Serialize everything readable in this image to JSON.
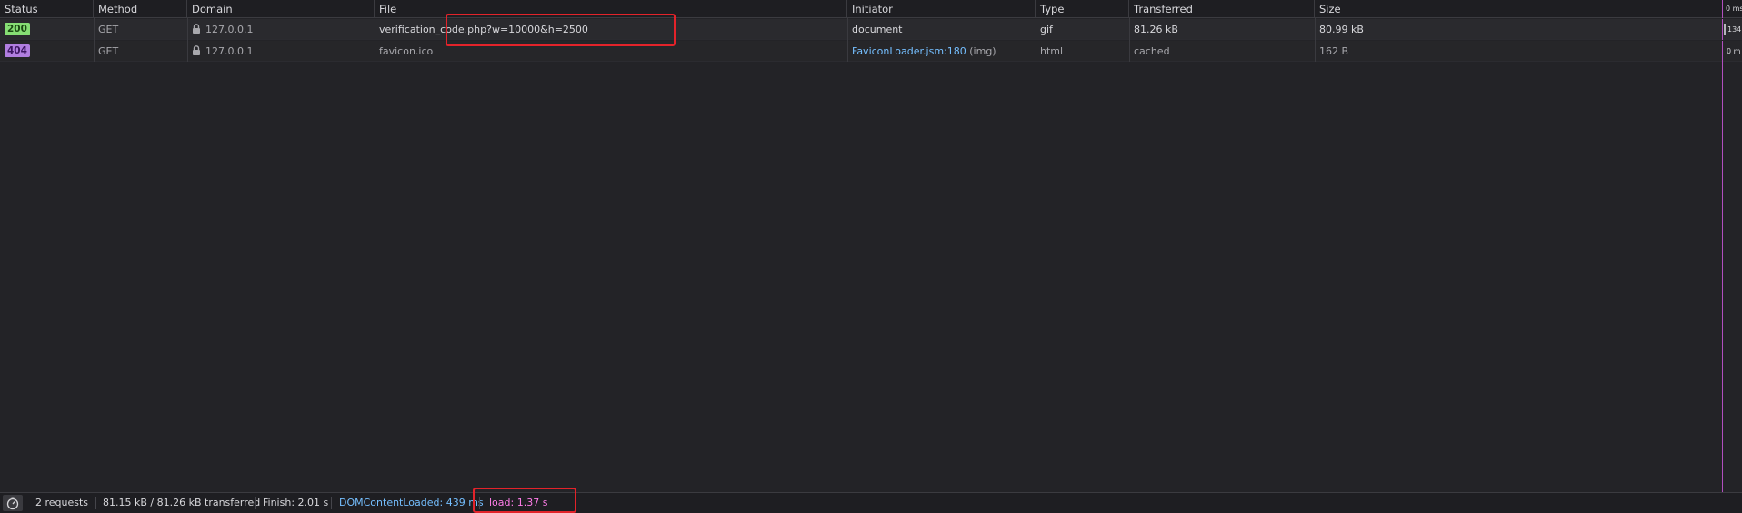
{
  "columns": {
    "status": "Status",
    "method": "Method",
    "domain": "Domain",
    "file": "File",
    "initiator": "Initiator",
    "type": "Type",
    "transferred": "Transferred",
    "size": "Size",
    "waterfall": "0 ms"
  },
  "requests": [
    {
      "status": "200",
      "method": "GET",
      "domain": "127.0.0.1",
      "file": "verification_code.php?w=10000&h=2500",
      "initiator": "document",
      "initiator_link": "",
      "initiator_suffix": "",
      "type": "gif",
      "transferred": "81.26 kB",
      "size": "80.99 kB",
      "waterfall_label": "134",
      "status_color": "#86de74"
    },
    {
      "status": "404",
      "method": "GET",
      "domain": "127.0.0.1",
      "file": "favicon.ico",
      "initiator": "",
      "initiator_link": "FaviconLoader.jsm:180",
      "initiator_suffix": "(img)",
      "type": "html",
      "transferred": "cached",
      "size": "162 B",
      "waterfall_label": "0 m",
      "status_color": "#b17ee0"
    }
  ],
  "statusbar": {
    "requests": "2 requests",
    "transferred": "81.15 kB / 81.26 kB transferred",
    "finish": "Finish: 2.01 s",
    "dom_content_loaded": "DOMContentLoaded: 439 ms",
    "load": "load: 1.37 s",
    "icon": "stopwatch-icon"
  },
  "colors": {
    "background": "#232327",
    "dom_content_loaded": "#75bfff",
    "load": "#ff7de9",
    "highlight": "#e3232a"
  }
}
